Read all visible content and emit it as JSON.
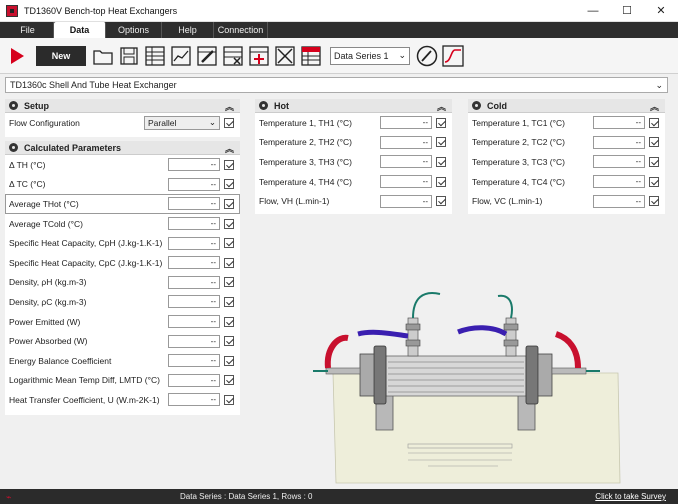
{
  "window": {
    "title": "TD1360V Bench-top Heat Exchangers",
    "minimize": "—",
    "maximize": "☐",
    "close": "✕"
  },
  "menu": {
    "tabs": [
      {
        "label": "File"
      },
      {
        "label": "Data"
      },
      {
        "label": "Options"
      },
      {
        "label": "Help"
      },
      {
        "label": "Connection"
      }
    ]
  },
  "toolbar": {
    "new_label": "New",
    "data_series_value": "Data Series 1"
  },
  "equipment": {
    "value": "TD1360c Shell And Tube Heat Exchanger"
  },
  "setup": {
    "title": "Setup",
    "flow_label": "Flow Configuration",
    "flow_value": "Parallel"
  },
  "calculated": {
    "title": "Calculated Parameters",
    "rows": [
      {
        "label": "Δ TH (°C)",
        "value": "--"
      },
      {
        "label": "Δ TC (°C)",
        "value": "--"
      },
      {
        "label": "Average THot (°C)",
        "value": "--"
      },
      {
        "label": "Average TCold (°C)",
        "value": "--"
      },
      {
        "label": "Specific Heat Capacity, CpH (J.kg-1.K-1)",
        "value": "--"
      },
      {
        "label": "Specific Heat Capacity, CpC (J.kg-1.K-1)",
        "value": "--"
      },
      {
        "label": "Density, ρH (kg.m-3)",
        "value": "--"
      },
      {
        "label": "Density, ρC (kg.m-3)",
        "value": "--"
      },
      {
        "label": "Power Emitted (W)",
        "value": "--"
      },
      {
        "label": "Power Absorbed (W)",
        "value": "--"
      },
      {
        "label": "Energy Balance Coefficient",
        "value": "--"
      },
      {
        "label": "Logarithmic Mean Temp Diff, LMTD (°C)",
        "value": "--"
      },
      {
        "label": "Heat Transfer Coefficient, U (W.m-2K-1)",
        "value": "--"
      }
    ]
  },
  "hot": {
    "title": "Hot",
    "rows": [
      {
        "label": "Temperature 1, TH1 (°C)",
        "value": "--"
      },
      {
        "label": "Temperature 2, TH2 (°C)",
        "value": "--"
      },
      {
        "label": "Temperature 3, TH3 (°C)",
        "value": "--"
      },
      {
        "label": "Temperature 4, TH4 (°C)",
        "value": "--"
      },
      {
        "label": "Flow, VH (L.min-1)",
        "value": "--"
      }
    ]
  },
  "cold": {
    "title": "Cold",
    "rows": [
      {
        "label": "Temperature 1, TC1 (°C)",
        "value": "--"
      },
      {
        "label": "Temperature 2, TC2 (°C)",
        "value": "--"
      },
      {
        "label": "Temperature 3, TC3 (°C)",
        "value": "--"
      },
      {
        "label": "Temperature 4, TC4 (°C)",
        "value": "--"
      },
      {
        "label": "Flow, VC (L.min-1)",
        "value": "--"
      }
    ]
  },
  "status": {
    "text": "Data Series : Data Series 1,  Rows : 0",
    "survey": "Click to take Survey"
  },
  "colors": {
    "accent_red": "#d6001c",
    "dark_bar": "#2b2b2b"
  }
}
